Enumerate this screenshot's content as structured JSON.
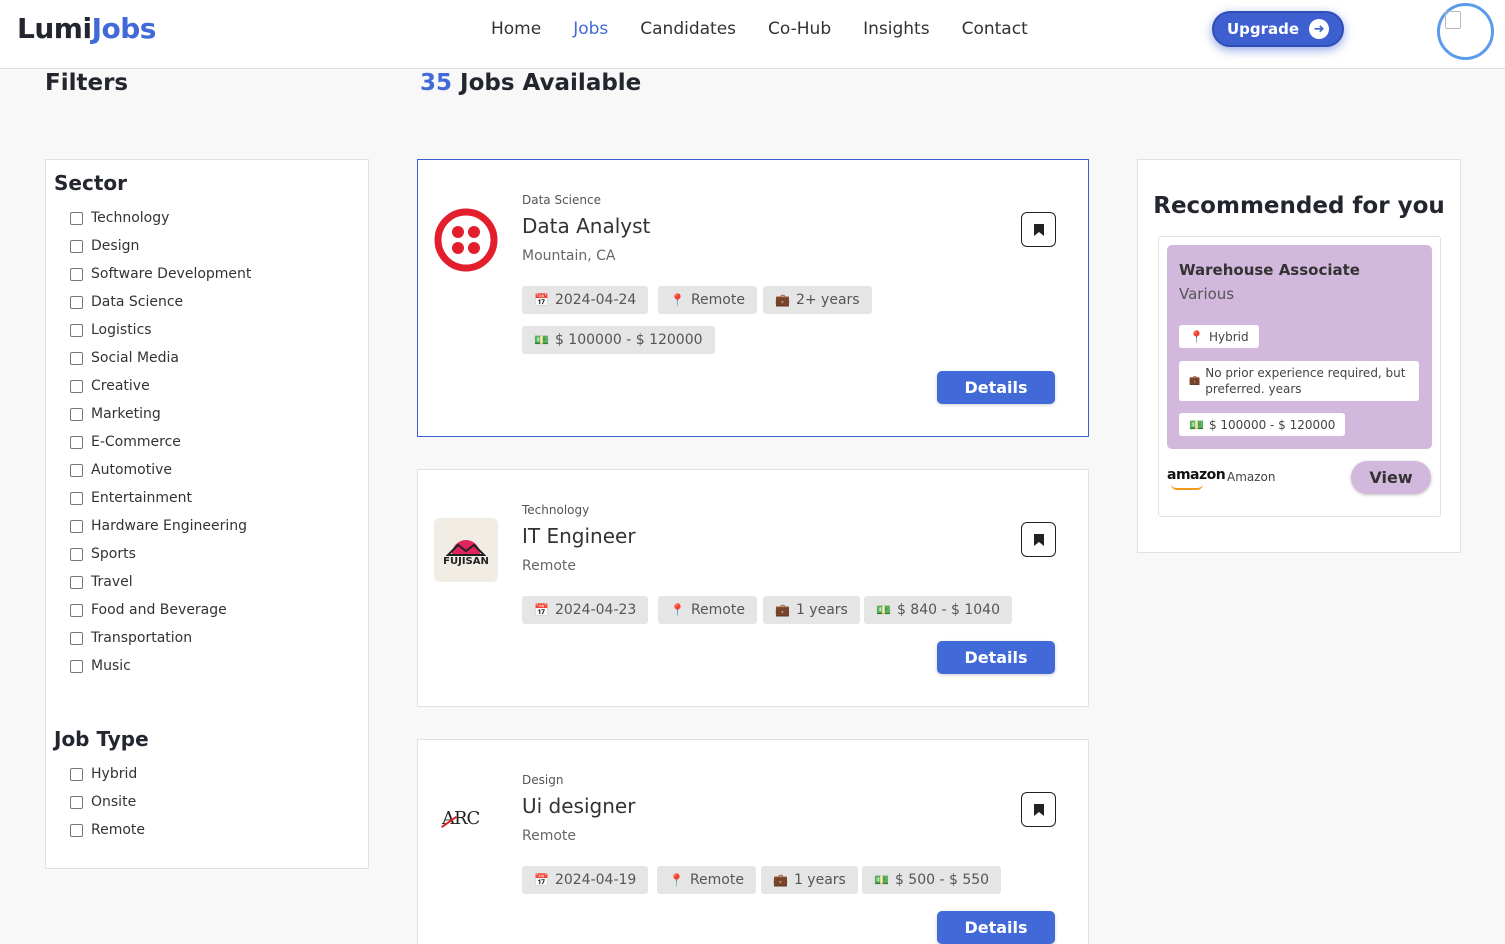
{
  "header": {
    "logo_part1": "Lumi",
    "logo_part2": "Jobs",
    "nav": [
      "Home",
      "Jobs",
      "Candidates",
      "Co-Hub",
      "Insights",
      "Contact"
    ],
    "active_nav": "Jobs",
    "upgrade_label": "Upgrade"
  },
  "filters": {
    "title": "Filters",
    "sector_title": "Sector",
    "sectors": [
      "Technology",
      "Design",
      "Software Development",
      "Data Science",
      "Logistics",
      "Social Media",
      "Creative",
      "Marketing",
      "E-Commerce",
      "Automotive",
      "Entertainment",
      "Hardware Engineering",
      "Sports",
      "Travel",
      "Food and Beverage",
      "Transportation",
      "Music"
    ],
    "job_type_title": "Job Type",
    "job_types": [
      "Hybrid",
      "Onsite",
      "Remote"
    ]
  },
  "jobs_header": {
    "count": "35",
    "label": "Jobs Available"
  },
  "jobs": [
    {
      "category": "Data Science",
      "title": "Data Analyst",
      "location": "Mountain, CA",
      "date": "2024-04-24",
      "mode": "Remote",
      "experience": "2+ years",
      "salary": "$ 100000 - $ 120000",
      "details_label": "Details",
      "logo": "twilio-logo"
    },
    {
      "category": "Technology",
      "title": "IT Engineer",
      "location": "Remote",
      "date": "2024-04-23",
      "mode": "Remote",
      "experience": "1 years",
      "salary": "$ 840 - $ 1040",
      "details_label": "Details",
      "logo": "fujisan-logo",
      "logo_text": "FUJISAN"
    },
    {
      "category": "Design",
      "title": "Ui designer",
      "location": "Remote",
      "date": "2024-04-19",
      "mode": "Remote",
      "experience": "1 years",
      "salary": "$ 500 - $ 550",
      "details_label": "Details",
      "logo": "arc-logo",
      "logo_text": "ARC"
    }
  ],
  "recommended": {
    "title": "Recommended for you",
    "job_title": "Warehouse Associate",
    "company_line": "Various",
    "mode": "Hybrid",
    "experience": "No prior experience required, but preferred. years",
    "salary": "$ 100000 - $ 120000",
    "company_logo_text": "amazon",
    "company_name": "Amazon",
    "view_label": "View"
  },
  "colors": {
    "accent": "#4169d8",
    "rec_card": "#d2b8dc",
    "twilio_red": "#e31e2d"
  }
}
